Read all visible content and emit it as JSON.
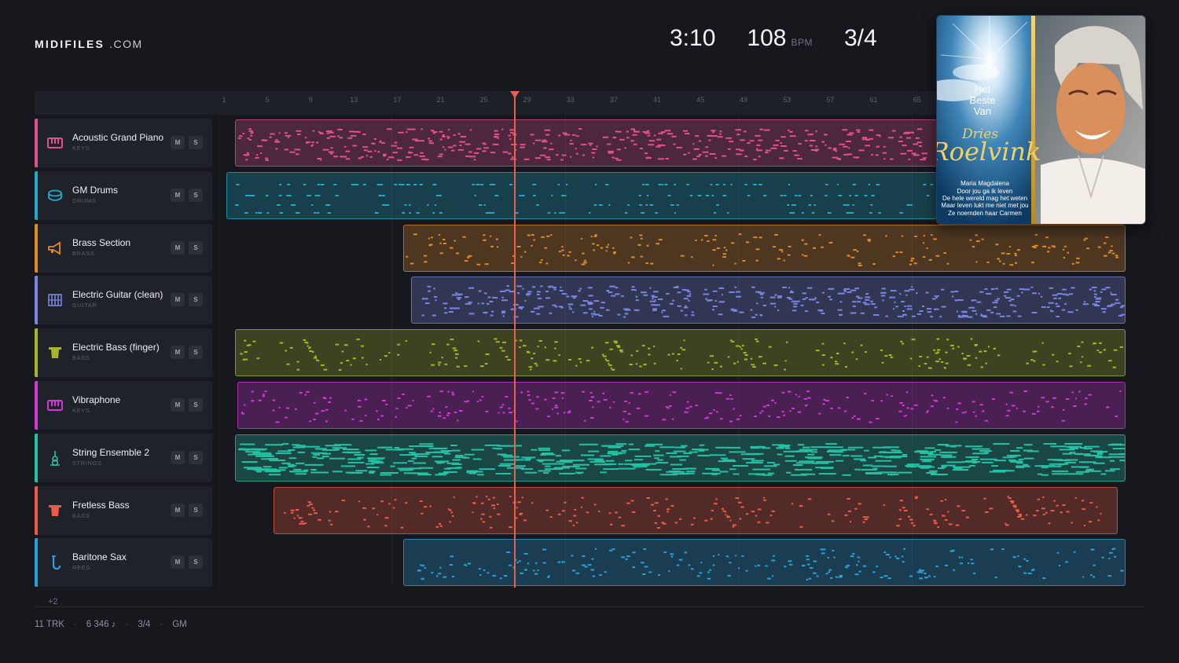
{
  "brand": {
    "name": "MIDIFILES",
    "domain": ".COM"
  },
  "hud": {
    "time": "3:10",
    "bpm": "108",
    "bpm_unit": "BPM",
    "meter": "3/4"
  },
  "ruler": {
    "ticks": [
      "1",
      "5",
      "9",
      "13",
      "17",
      "21",
      "25",
      "29",
      "33",
      "37",
      "41",
      "45",
      "49",
      "53",
      "57",
      "61",
      "65"
    ]
  },
  "tracks": [
    {
      "name": "Acoustic Grand Piano",
      "category": "KEYS",
      "color": "#e0508a",
      "icon": "piano-keys-icon",
      "mute": "M",
      "solo": "S"
    },
    {
      "name": "GM Drums",
      "category": "DRUMS",
      "color": "#22a9c7",
      "icon": "drum-icon",
      "mute": "M",
      "solo": "S"
    },
    {
      "name": "Brass Section",
      "category": "BRASS",
      "color": "#e0892a",
      "icon": "horn-icon",
      "mute": "M",
      "solo": "S"
    },
    {
      "name": "Electric Guitar (clean)",
      "category": "GUITAR",
      "color": "#7b84e0",
      "icon": "guitar-fretboard-icon",
      "mute": "M",
      "solo": "S"
    },
    {
      "name": "Electric Bass (finger)",
      "category": "BASS",
      "color": "#a7b52a",
      "icon": "bass-icon",
      "mute": "M",
      "solo": "S"
    },
    {
      "name": "Vibraphone",
      "category": "KEYS",
      "color": "#d236d8",
      "icon": "vibraphone-keys-icon",
      "mute": "M",
      "solo": "S"
    },
    {
      "name": "String Ensemble 2",
      "category": "STRINGS",
      "color": "#26c0a5",
      "icon": "violin-icon",
      "mute": "M",
      "solo": "S"
    },
    {
      "name": "Fretless Bass",
      "category": "BASS",
      "color": "#ef5a45",
      "icon": "fretless-bass-icon",
      "mute": "M",
      "solo": "S"
    },
    {
      "name": "Baritone Sax",
      "category": "REED",
      "color": "#2b9fdc",
      "icon": "saxophone-icon",
      "mute": "M",
      "solo": "S"
    }
  ],
  "more_tracks": "+2",
  "footer": {
    "tracks": "11 TRK",
    "notes": "6 346 ♪",
    "meter": "3/4",
    "standard": "GM"
  },
  "album": {
    "prefix": [
      "Het",
      "Beste",
      "Van"
    ],
    "artist_first": "Dries",
    "artist_last": "Roelvink",
    "songs": [
      "Maria Magdalena",
      "Door jou ga ik leven",
      "De hele wereld mag het weten",
      "Maar leven lukt me niet met jou",
      "Ze noemden haar Carmen"
    ]
  }
}
